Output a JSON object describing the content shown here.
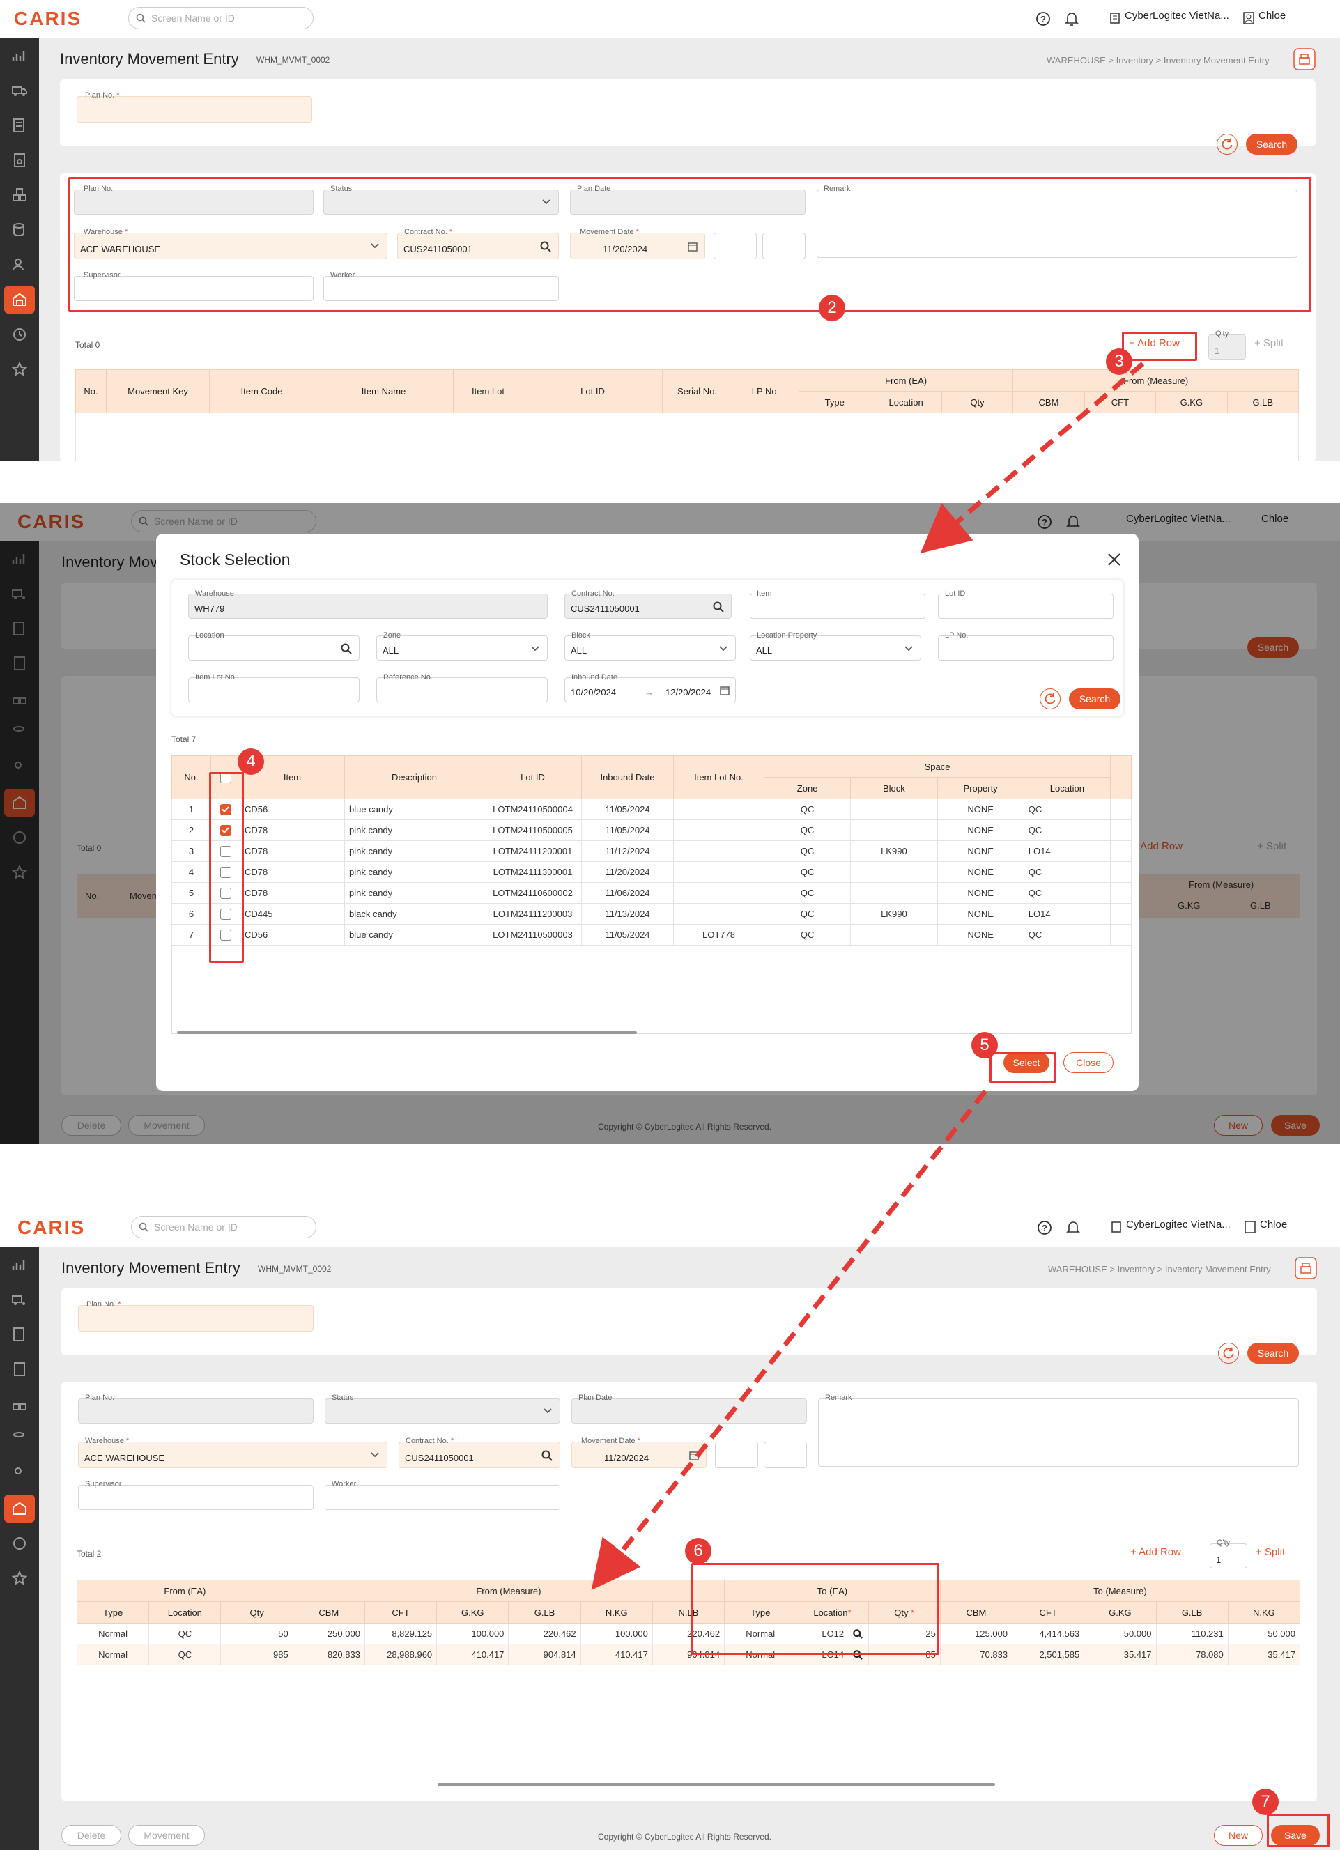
{
  "app": {
    "logo": "CARIS",
    "search_placeholder": "Screen Name or ID",
    "company": "CyberLogitec VietNa...",
    "user": "Chloe"
  },
  "page": {
    "title": "Inventory Movement Entry",
    "code": "WHM_MVMT_0002",
    "breadcrumb": [
      "WAREHOUSE",
      "Inventory",
      "Inventory Movement Entry"
    ]
  },
  "search_form": {
    "plan_no_label": "Plan No.",
    "search": "Search"
  },
  "detail_form": {
    "plan_no": "Plan No.",
    "status": "Status",
    "plan_date": "Plan Date",
    "remark": "Remark",
    "warehouse": "Warehouse",
    "warehouse_value": "ACE WAREHOUSE",
    "contract": "Contract No.",
    "contract_value": "CUS2411050001",
    "movement_date": "Movement Date",
    "movement_date_value": "11/20/2024",
    "supervisor": "Supervisor",
    "worker": "Worker"
  },
  "grid_toolbar": {
    "add_row": "+ Add Row",
    "qty_label": "Q'ty",
    "qty_value": "1",
    "split": "+ Split"
  },
  "panel1": {
    "total": "Total 0",
    "headers": [
      "No.",
      "Movement Key",
      "Item Code",
      "Item Name",
      "Item Lot",
      "Lot ID",
      "Serial No.",
      "LP No."
    ],
    "group_from_ea": "From (EA)",
    "group_from_measure": "From (Measure)",
    "sub_ea": [
      "Type",
      "Location",
      "Qty"
    ],
    "sub_measure": [
      "CBM",
      "CFT",
      "G.KG",
      "G.LB"
    ]
  },
  "modal": {
    "title": "Stock Selection",
    "warehouse_label": "Warehouse",
    "warehouse_value": "WH779",
    "contract_label": "Contract No.",
    "contract_value": "CUS2411050001",
    "item_label": "Item",
    "lot_label": "Lot ID",
    "location_label": "Location",
    "zone_label": "Zone",
    "zone_value": "ALL",
    "block_label": "Block",
    "block_value": "ALL",
    "locprop_label": "Location Property",
    "locprop_value": "ALL",
    "lpno_label": "LP No.",
    "itemlot_label": "Item Lot No.",
    "ref_label": "Reference No.",
    "inbound_label": "Inbound Date",
    "inbound_from": "10/20/2024",
    "inbound_to": "12/20/2024",
    "search": "Search",
    "total": "Total 7",
    "headers": [
      "No.",
      "Item",
      "Description",
      "Lot ID",
      "Inbound Date",
      "Item Lot No."
    ],
    "space_group": "Space",
    "space_sub": [
      "Zone",
      "Block",
      "Property",
      "Location"
    ],
    "rows": [
      {
        "no": "1",
        "checked": true,
        "item": "CD56",
        "desc": "blue candy",
        "lot": "LOTM24110500004",
        "date": "11/05/2024",
        "itemlot": "",
        "zone": "QC",
        "block": "",
        "prop": "NONE",
        "loc": "QC"
      },
      {
        "no": "2",
        "checked": true,
        "item": "CD78",
        "desc": "pink candy",
        "lot": "LOTM24110500005",
        "date": "11/05/2024",
        "itemlot": "",
        "zone": "QC",
        "block": "",
        "prop": "NONE",
        "loc": "QC"
      },
      {
        "no": "3",
        "checked": false,
        "item": "CD78",
        "desc": "pink candy",
        "lot": "LOTM24111200001",
        "date": "11/12/2024",
        "itemlot": "",
        "zone": "QC",
        "block": "LK990",
        "prop": "NONE",
        "loc": "LO14"
      },
      {
        "no": "4",
        "checked": false,
        "item": "CD78",
        "desc": "pink candy",
        "lot": "LOTM24111300001",
        "date": "11/20/2024",
        "itemlot": "",
        "zone": "QC",
        "block": "",
        "prop": "NONE",
        "loc": "QC"
      },
      {
        "no": "5",
        "checked": false,
        "item": "CD78",
        "desc": "pink candy",
        "lot": "LOTM24110600002",
        "date": "11/06/2024",
        "itemlot": "",
        "zone": "QC",
        "block": "",
        "prop": "NONE",
        "loc": "QC"
      },
      {
        "no": "6",
        "checked": false,
        "item": "CD445",
        "desc": "black candy",
        "lot": "LOTM24111200003",
        "date": "11/13/2024",
        "itemlot": "",
        "zone": "QC",
        "block": "LK990",
        "prop": "NONE",
        "loc": "LO14"
      },
      {
        "no": "7",
        "checked": false,
        "item": "CD56",
        "desc": "blue candy",
        "lot": "LOTM24110500003",
        "date": "11/05/2024",
        "itemlot": "LOT778",
        "zone": "QC",
        "block": "",
        "prop": "NONE",
        "loc": "QC"
      }
    ],
    "select": "Select",
    "close": "Close"
  },
  "panel2_bg": {
    "total": "Total 0",
    "no": "No.",
    "movement": "Movem",
    "from_measure": "From (Measure)",
    "gkg": "G.KG",
    "glb": "G.LB"
  },
  "panel3": {
    "total": "Total 2",
    "groups": {
      "from_ea": "From (EA)",
      "from_measure": "From (Measure)",
      "to_ea": "To (EA)",
      "to_measure": "To (Measure)"
    },
    "sub_from_ea": [
      "Type",
      "Location",
      "Qty"
    ],
    "sub_from_measure": [
      "CBM",
      "CFT",
      "G.KG",
      "G.LB",
      "N.KG",
      "N.LB"
    ],
    "sub_to_ea": [
      "Type",
      "Location",
      "Qty"
    ],
    "sub_to_measure": [
      "CBM",
      "CFT",
      "G.KG",
      "G.LB",
      "N.KG"
    ],
    "rows": [
      {
        "ftype": "Normal",
        "floc": "QC",
        "fqty": "50",
        "cbm": "250.000",
        "cft": "8,829.125",
        "gkg": "100.000",
        "glb": "220.462",
        "nkg": "100.000",
        "nlb": "220.462",
        "ttype": "Normal",
        "tloc": "LO12",
        "tqty": "25",
        "tcbm": "125.000",
        "tcft": "4,414.563",
        "tgkg": "50.000",
        "tglb": "110.231",
        "tnkg": "50.000"
      },
      {
        "ftype": "Normal",
        "floc": "QC",
        "fqty": "985",
        "cbm": "820.833",
        "cft": "28,988.960",
        "gkg": "410.417",
        "glb": "904.814",
        "nkg": "410.417",
        "nlb": "904.814",
        "ttype": "Normal",
        "tloc": "LO14",
        "tqty": "85",
        "tcbm": "70.833",
        "tcft": "2,501.585",
        "tgkg": "35.417",
        "tglb": "78.080",
        "tnkg": "35.417"
      }
    ]
  },
  "footer": {
    "delete": "Delete",
    "movement": "Movement",
    "copyright": "Copyright © CyberLogitec All Rights Reserved.",
    "new": "New",
    "save": "Save"
  },
  "steps": [
    "2",
    "3",
    "4",
    "5",
    "6",
    "7"
  ],
  "colors": {
    "accent": "#e8542a",
    "annotation": "#e53935",
    "header_bg": "#fde6d4",
    "sidebar": "#2e2e2e"
  }
}
